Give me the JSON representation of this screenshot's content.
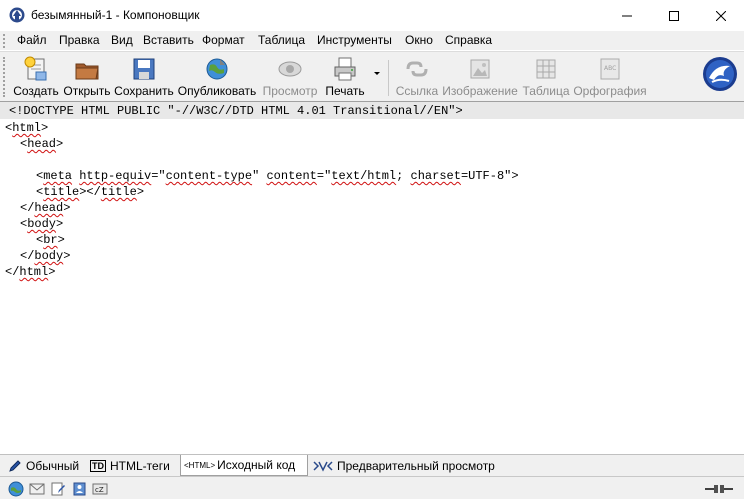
{
  "window": {
    "title": "безымянный-1 - Компоновщик"
  },
  "menu": {
    "items": [
      "Файл",
      "Правка",
      "Вид",
      "Вставить",
      "Формат",
      "Таблица",
      "Инструменты",
      "Окно",
      "Справка"
    ]
  },
  "toolbar": {
    "buttons": [
      {
        "label": "Создать",
        "icon": "new-document-icon",
        "enabled": true
      },
      {
        "label": "Открыть",
        "icon": "open-folder-icon",
        "enabled": true
      },
      {
        "label": "Сохранить",
        "icon": "save-disk-icon",
        "enabled": true
      },
      {
        "label": "Опубликовать",
        "icon": "publish-globe-icon",
        "enabled": true
      },
      {
        "label": "Просмотр",
        "icon": "preview-eye-icon",
        "enabled": false
      },
      {
        "label": "Печать",
        "icon": "print-icon",
        "enabled": true
      },
      {
        "label": "Ссылка",
        "icon": "link-icon",
        "enabled": false
      },
      {
        "label": "Изображение",
        "icon": "image-icon",
        "enabled": false
      },
      {
        "label": "Таблица",
        "icon": "table-icon",
        "enabled": false
      },
      {
        "label": "Орфография",
        "icon": "spellcheck-icon",
        "enabled": false
      }
    ]
  },
  "editor": {
    "lines": [
      "<!DOCTYPE HTML PUBLIC \"-//W3C//DTD HTML 4.01 Transitional//EN\">",
      "<html>",
      "  <head>",
      "",
      "    <meta http-equiv=\"content-type\" content=\"text/html; charset=UTF-8\">",
      "    <title></title>",
      "  </head>",
      "  <body>",
      "    <br>",
      "  </body>",
      "</html>"
    ]
  },
  "tabs": {
    "items": [
      {
        "label": "Обычный",
        "icon": "pen-icon",
        "active": false
      },
      {
        "label": "HTML-теги",
        "icon": "td-tag-icon",
        "icon_text": "TD",
        "active": false
      },
      {
        "label": "Исходный код",
        "icon": "html-source-icon",
        "icon_text": "<HTML>",
        "active": true
      },
      {
        "label": "Предварительный просмотр",
        "icon": "preview-icon",
        "active": false
      }
    ]
  },
  "statusbar": {
    "icons": [
      "browser-globe-icon",
      "mail-icon",
      "composer-icon",
      "address-book-icon",
      "irc-chat-icon",
      "online-status-icon"
    ]
  },
  "colors": {
    "toolbar_bg": "#f0f0f0",
    "doctype_highlight": "#e8e8e8",
    "spell_underline": "#d01010",
    "disabled_text": "#8c8c8c"
  }
}
